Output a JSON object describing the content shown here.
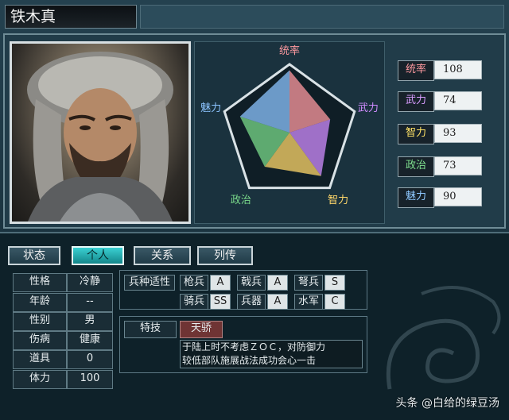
{
  "character": {
    "name": "铁木真"
  },
  "radar": {
    "axes": [
      "统率",
      "武力",
      "智力",
      "政治",
      "魅力"
    ],
    "axis_colors": [
      "#ff9aa0",
      "#d08cff",
      "#ffd76a",
      "#7ad98a",
      "#8cc4ff"
    ],
    "values": [
      108,
      74,
      93,
      73,
      90
    ]
  },
  "stats": [
    {
      "label": "统率",
      "value": "108",
      "color": "#ff9aa0"
    },
    {
      "label": "武力",
      "value": "74",
      "color": "#d99cff"
    },
    {
      "label": "智力",
      "value": "93",
      "color": "#ffe266"
    },
    {
      "label": "政治",
      "value": "73",
      "color": "#7fe08e"
    },
    {
      "label": "魅力",
      "value": "90",
      "color": "#8fc8ff"
    }
  ],
  "tabs": [
    {
      "label": "状态",
      "active": false
    },
    {
      "label": "个人",
      "active": true
    },
    {
      "label": "关系",
      "active": false
    },
    {
      "label": "列传",
      "active": false
    }
  ],
  "info": [
    {
      "label": "性格",
      "value": "冷静"
    },
    {
      "label": "年龄",
      "value": "--"
    },
    {
      "label": "性别",
      "value": "男"
    },
    {
      "label": "伤病",
      "value": "健康"
    },
    {
      "label": "道具",
      "value": "0"
    },
    {
      "label": "体力",
      "value": "100"
    }
  ],
  "aptitude": {
    "title": "兵种适性",
    "rows": [
      [
        {
          "type": "枪兵",
          "grade": "A"
        },
        {
          "type": "戟兵",
          "grade": "A"
        },
        {
          "type": "弩兵",
          "grade": "S"
        }
      ],
      [
        {
          "type": "骑兵",
          "grade": "SS"
        },
        {
          "type": "兵器",
          "grade": "A"
        },
        {
          "type": "水军",
          "grade": "C"
        }
      ]
    ]
  },
  "skill": {
    "title": "特技",
    "name": "天骄",
    "description_lines": [
      "于陆上时不考虑ＺＯＣ，对防御力",
      "较低部队施展战法成功会心一击"
    ]
  },
  "watermark": "头条 @白给的绿豆汤"
}
